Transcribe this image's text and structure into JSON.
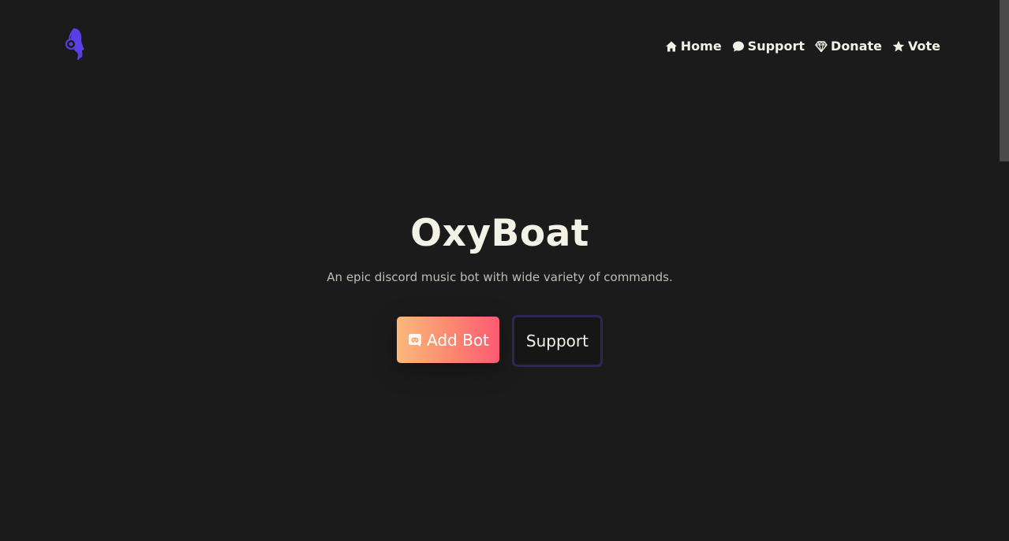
{
  "header": {
    "logo_icon": "headphone-head-logo-icon",
    "nav": [
      {
        "icon": "home-icon",
        "label": "Home"
      },
      {
        "icon": "chat-bubble-icon",
        "label": "Support"
      },
      {
        "icon": "diamond-icon",
        "label": "Donate"
      },
      {
        "icon": "star-icon",
        "label": "Vote"
      }
    ]
  },
  "hero": {
    "title": "OxyBoat",
    "subtitle": "An epic discord music bot with wide variety of commands.",
    "add_bot_label": "Add Bot",
    "add_bot_icon": "discord-icon",
    "support_label": "Support"
  },
  "colors": {
    "background": "#1b1b1c",
    "text": "#f2f2e6",
    "logo": "#5a3fe6",
    "gradient_start": "#fcb87c",
    "gradient_end": "#fc5a72",
    "support_border": "#2c2755"
  }
}
